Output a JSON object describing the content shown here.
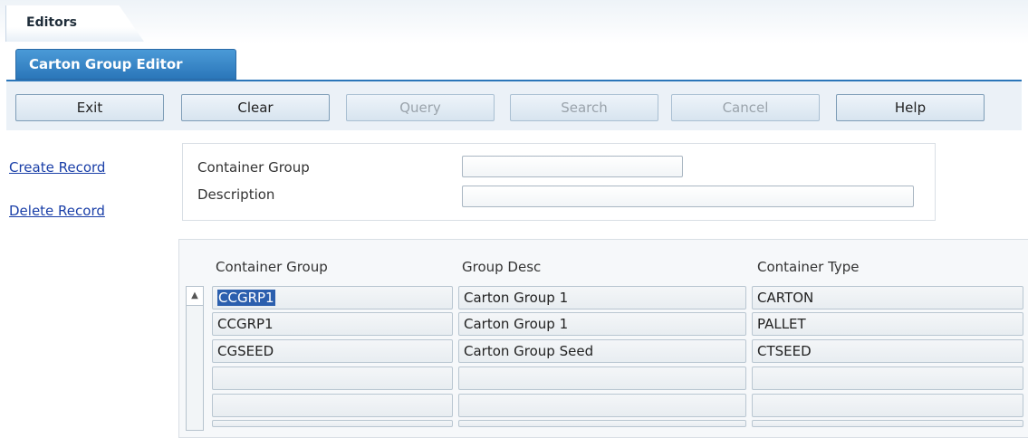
{
  "tabs": {
    "main": "Editors",
    "sub": "Carton Group Editor"
  },
  "toolbar": {
    "buttons": [
      "Exit",
      "Clear",
      "Query",
      "Search",
      "Cancel",
      "Help"
    ]
  },
  "sidebar": {
    "create": "Create Record",
    "delete": "Delete Record"
  },
  "form": {
    "container_group_label": "Container Group",
    "description_label": "Description",
    "container_group_value": "",
    "description_value": ""
  },
  "grid": {
    "headers": [
      "Container Group",
      "Group Desc",
      "Container Type"
    ],
    "rows": [
      [
        "CCGRP1",
        "Carton Group 1",
        "CARTON"
      ],
      [
        "CCGRP1",
        "Carton Group 1",
        "PALLET"
      ],
      [
        "CGSEED",
        "Carton Group Seed",
        "CTSEED"
      ],
      [
        "",
        "",
        ""
      ],
      [
        "",
        "",
        ""
      ],
      [
        "",
        "",
        ""
      ]
    ]
  },
  "colors": {
    "accent": "#2b76b9",
    "link": "#1a3fa8",
    "selected": "#2b5fae"
  }
}
